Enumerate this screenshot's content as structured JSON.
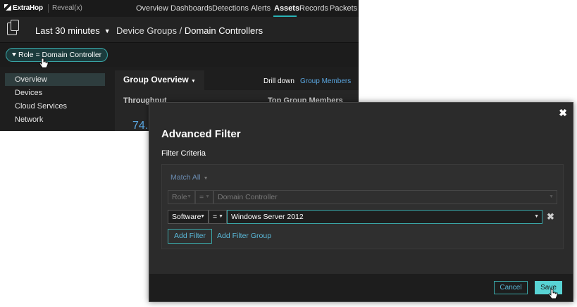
{
  "top_nav": {
    "logo": "ExtraHop",
    "product": "Reveal(x)",
    "items": [
      "Overview",
      "Dashboards",
      "Detections",
      "Alerts",
      "Assets",
      "Records",
      "Packets"
    ],
    "active": "Assets"
  },
  "sub_bar": {
    "time_range": "Last 30 minutes",
    "breadcrumb_parent": "Device Groups",
    "breadcrumb_separator": "/",
    "breadcrumb_current": "Domain Controllers"
  },
  "filter_pill": {
    "label": "Role = Domain Controller"
  },
  "sidebar": {
    "items": [
      "Overview",
      "Devices",
      "Cloud Services",
      "Network"
    ],
    "active": "Overview"
  },
  "main": {
    "group_overview": "Group Overview",
    "drill_down": "Drill down",
    "group_members": "Group Members",
    "throughput_label": "Throughput",
    "top_group_members": "Top Group Members",
    "big_value": "74."
  },
  "modal": {
    "title": "Advanced Filter",
    "criteria_label": "Filter Criteria",
    "match_all": "Match All",
    "rows": [
      {
        "field": "Role",
        "operator": "=",
        "value": "Domain Controller",
        "enabled": false
      },
      {
        "field": "Software",
        "operator": "=",
        "value": "Windows Server 2012",
        "enabled": true
      }
    ],
    "add_filter": "Add Filter",
    "add_filter_group": "Add Filter Group",
    "cancel": "Cancel",
    "save": "Save",
    "close_glyph": "✖",
    "remove_glyph": "✖"
  },
  "colors": {
    "accent": "#3aa7a8",
    "save_bg": "#58d3d4",
    "link": "#5ab8d8",
    "background": "#1e1e1e"
  }
}
